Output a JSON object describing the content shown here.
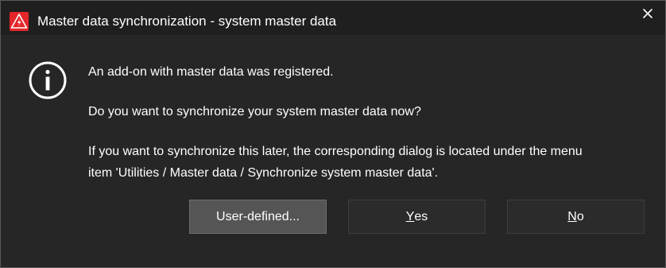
{
  "window": {
    "title": "Master data synchronization - system master data",
    "app_icon": "warning-triangle-icon",
    "close_icon": "close-icon",
    "accent_color": "#e3262a"
  },
  "message": {
    "icon": "info-icon",
    "line1": "An add-on with master data was registered.",
    "line2": "Do you want to synchronize your system master data now?",
    "line3a": "If you want to synchronize this later, the corresponding dialog is located under the menu",
    "line3b": "item 'Utilities / Master data / Synchronize system master data'."
  },
  "buttons": {
    "user_defined": "User-defined...",
    "yes_mnemonic": "Y",
    "yes_rest": "es",
    "no_mnemonic": "N",
    "no_rest": "o"
  }
}
